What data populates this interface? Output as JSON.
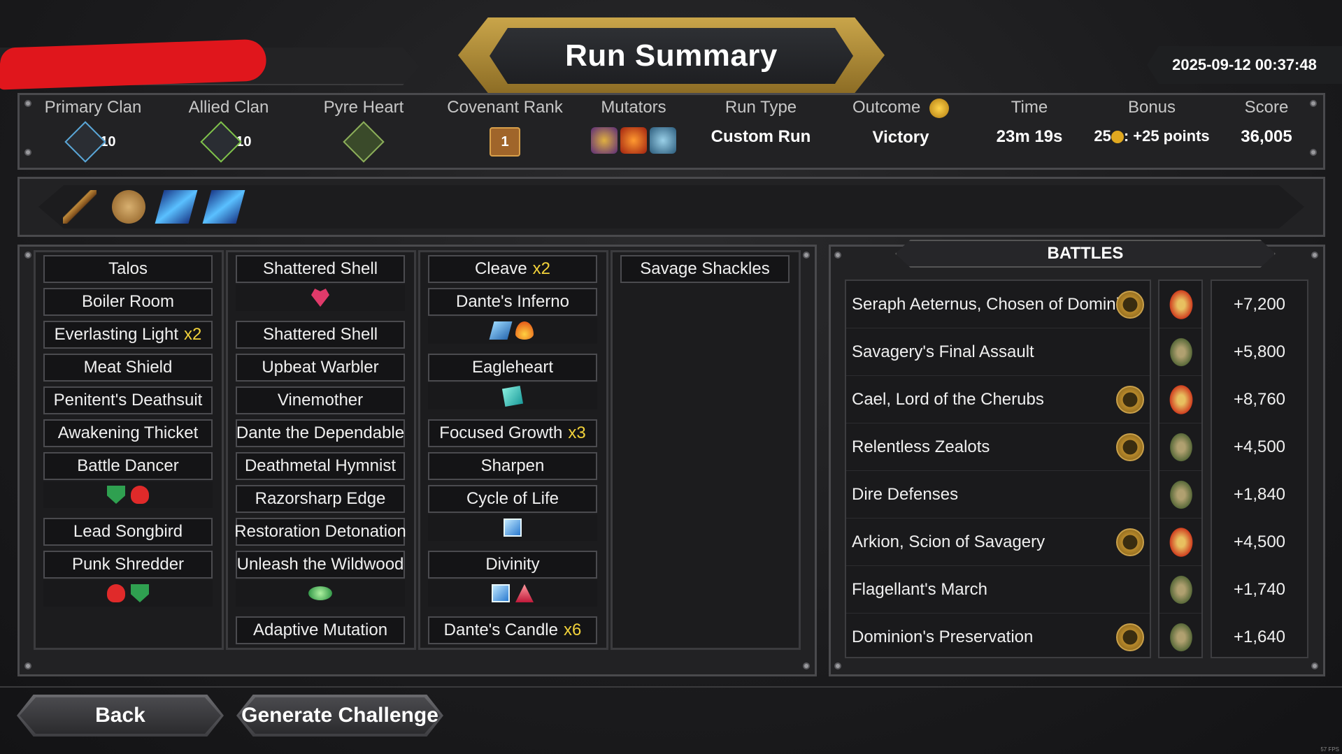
{
  "header": {
    "title": "Run Summary",
    "datetime": "2025-09-12 00:37:48"
  },
  "stats": {
    "primary_clan": {
      "label": "Primary Clan",
      "level": "10"
    },
    "allied_clan": {
      "label": "Allied Clan",
      "level": "10"
    },
    "pyre_heart": {
      "label": "Pyre Heart"
    },
    "covenant_rank": {
      "label": "Covenant Rank",
      "value": "1"
    },
    "mutators": {
      "label": "Mutators",
      "icons": [
        "twin-orbs-icon",
        "fire-orb-icon",
        "crossed-blades-icon"
      ]
    },
    "run_type": {
      "label": "Run Type",
      "value": "Custom Run"
    },
    "outcome": {
      "label": "Outcome",
      "value": "Victory"
    },
    "time": {
      "label": "Time",
      "value": "23m 19s"
    },
    "bonus": {
      "label": "Bonus",
      "value_prefix": "25",
      "value_suffix": ": +25 points"
    },
    "score": {
      "label": "Score",
      "value": "36,005"
    }
  },
  "relics": [
    "rifle-icon",
    "compass-icon",
    "blue-crystal-icon",
    "blue-crystal-icon"
  ],
  "deck": {
    "col1": [
      {
        "name": "Talos"
      },
      {
        "name": "Boiler Room"
      },
      {
        "name": "Everlasting Light",
        "mult": "x2"
      },
      {
        "name": "Meat Shield"
      },
      {
        "name": "Penitent's Deathsuit"
      },
      {
        "name": "Awakening Thicket"
      },
      {
        "name": "Battle Dancer",
        "upgrades": [
          "green-shield-icon",
          "red-heart-icon"
        ]
      },
      {
        "name": "Lead Songbird"
      },
      {
        "name": "Punk Shredder",
        "upgrades": [
          "red-heart-icon",
          "green-shield-icon"
        ]
      }
    ],
    "col2": [
      {
        "name": "Shattered Shell",
        "upgrades": [
          "pink-heart-gem-icon"
        ]
      },
      {
        "name": "Shattered Shell"
      },
      {
        "name": "Upbeat Warbler"
      },
      {
        "name": "Vinemother"
      },
      {
        "name": "Dante the Dependable"
      },
      {
        "name": "Deathmetal Hymnist"
      },
      {
        "name": "Razorsharp Edge"
      },
      {
        "name": "Restoration Detonation"
      },
      {
        "name": "Unleash the Wildwood",
        "upgrades": [
          "green-eye-gem-icon"
        ]
      },
      {
        "name": "Adaptive Mutation"
      }
    ],
    "col3": [
      {
        "name": "Cleave",
        "mult": "x2"
      },
      {
        "name": "Dante's Inferno",
        "upgrades": [
          "blue-scroll-icon",
          "flame-icon"
        ]
      },
      {
        "name": "Eagleheart",
        "upgrades": [
          "teal-card-icon"
        ]
      },
      {
        "name": "Focused Growth",
        "mult": "x3"
      },
      {
        "name": "Sharpen"
      },
      {
        "name": "Cycle of Life",
        "upgrades": [
          "blue-cube-icon"
        ]
      },
      {
        "name": "Divinity",
        "upgrades": [
          "blue-cube-icon",
          "red-crystal-icon"
        ]
      },
      {
        "name": "Dante's Candle",
        "mult": "x6"
      }
    ],
    "col4": [
      {
        "name": "Savage Shackles"
      }
    ]
  },
  "battles": {
    "title": "BATTLES",
    "rows": [
      {
        "name": "Seraph Aeternus, Chosen of Dominion",
        "badge": true,
        "boss": true,
        "score": "+7,200"
      },
      {
        "name": "Savagery's Final Assault",
        "badge": false,
        "boss": false,
        "score": "+5,800"
      },
      {
        "name": "Cael, Lord of the Cherubs",
        "badge": true,
        "boss": true,
        "score": "+8,760"
      },
      {
        "name": "Relentless Zealots",
        "badge": true,
        "boss": false,
        "score": "+4,500"
      },
      {
        "name": "Dire Defenses",
        "badge": false,
        "boss": false,
        "score": "+1,840"
      },
      {
        "name": "Arkion, Scion of Savagery",
        "badge": true,
        "boss": true,
        "score": "+4,500"
      },
      {
        "name": "Flagellant's March",
        "badge": false,
        "boss": false,
        "score": "+1,740"
      },
      {
        "name": "Dominion's Preservation",
        "badge": true,
        "boss": false,
        "score": "+1,640"
      }
    ]
  },
  "buttons": {
    "back": "Back",
    "generate": "Generate Challenge"
  },
  "fps": "57 FPS"
}
